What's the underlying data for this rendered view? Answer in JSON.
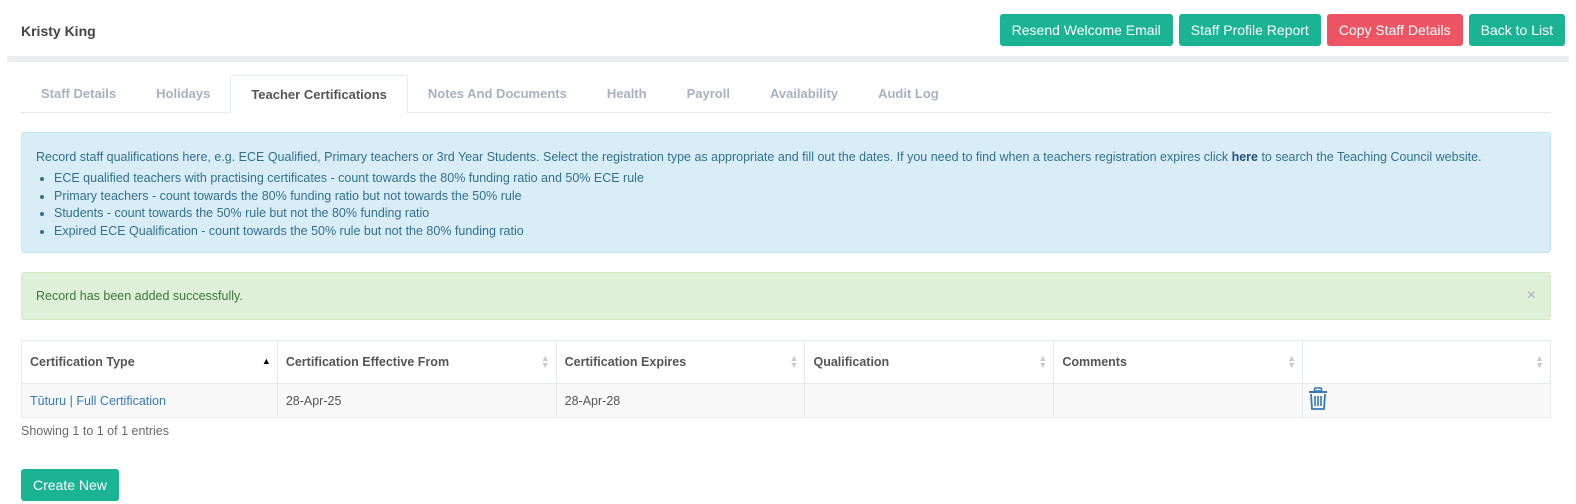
{
  "header": {
    "staff_name": "Kristy King",
    "buttons": {
      "resend": "Resend Welcome Email",
      "profile_report": "Staff Profile Report",
      "copy": "Copy Staff Details",
      "back": "Back to List"
    }
  },
  "tabs": [
    {
      "label": "Staff Details"
    },
    {
      "label": "Holidays"
    },
    {
      "label": "Teacher Certifications",
      "active": true
    },
    {
      "label": "Notes And Documents"
    },
    {
      "label": "Health"
    },
    {
      "label": "Payroll"
    },
    {
      "label": "Availability"
    },
    {
      "label": "Audit Log"
    }
  ],
  "info": {
    "intro_before": "Record staff qualifications here, e.g. ECE Qualified, Primary teachers or 3rd Year Students. Select the registration type as appropriate and fill out the dates. If you need to find when a teachers registration expires click ",
    "link": "here",
    "intro_after": " to search the Teaching Council website.",
    "bullets": [
      "ECE qualified teachers with practising certificates - count towards the 80% funding ratio and 50% ECE rule",
      "Primary teachers - count towards the 80% funding ratio but not towards the 50% rule",
      "Students - count towards the 50% rule but not the 80% funding ratio",
      "Expired ECE Qualification - count towards the 50% rule but not the 80% funding ratio"
    ]
  },
  "success": {
    "message": "Record has been added successfully.",
    "close": "×"
  },
  "table": {
    "columns": [
      "Certification Type",
      "Certification Effective From",
      "Certification Expires",
      "Qualification",
      "Comments",
      ""
    ],
    "rows": [
      {
        "type": "Tūturu | Full Certification",
        "effective_from": "28-Apr-25",
        "expires": "28-Apr-28",
        "qualification": "",
        "comments": ""
      }
    ],
    "showing": "Showing 1 to 1 of 1 entries"
  },
  "create_label": "Create New",
  "colors": {
    "primary": "#1ab394",
    "danger": "#ed5565",
    "info_bg": "#d9edf7",
    "success_bg": "#dff0d8",
    "link": "#337ab7"
  },
  "icons": {
    "delete": "trash-icon",
    "close": "close-icon"
  }
}
